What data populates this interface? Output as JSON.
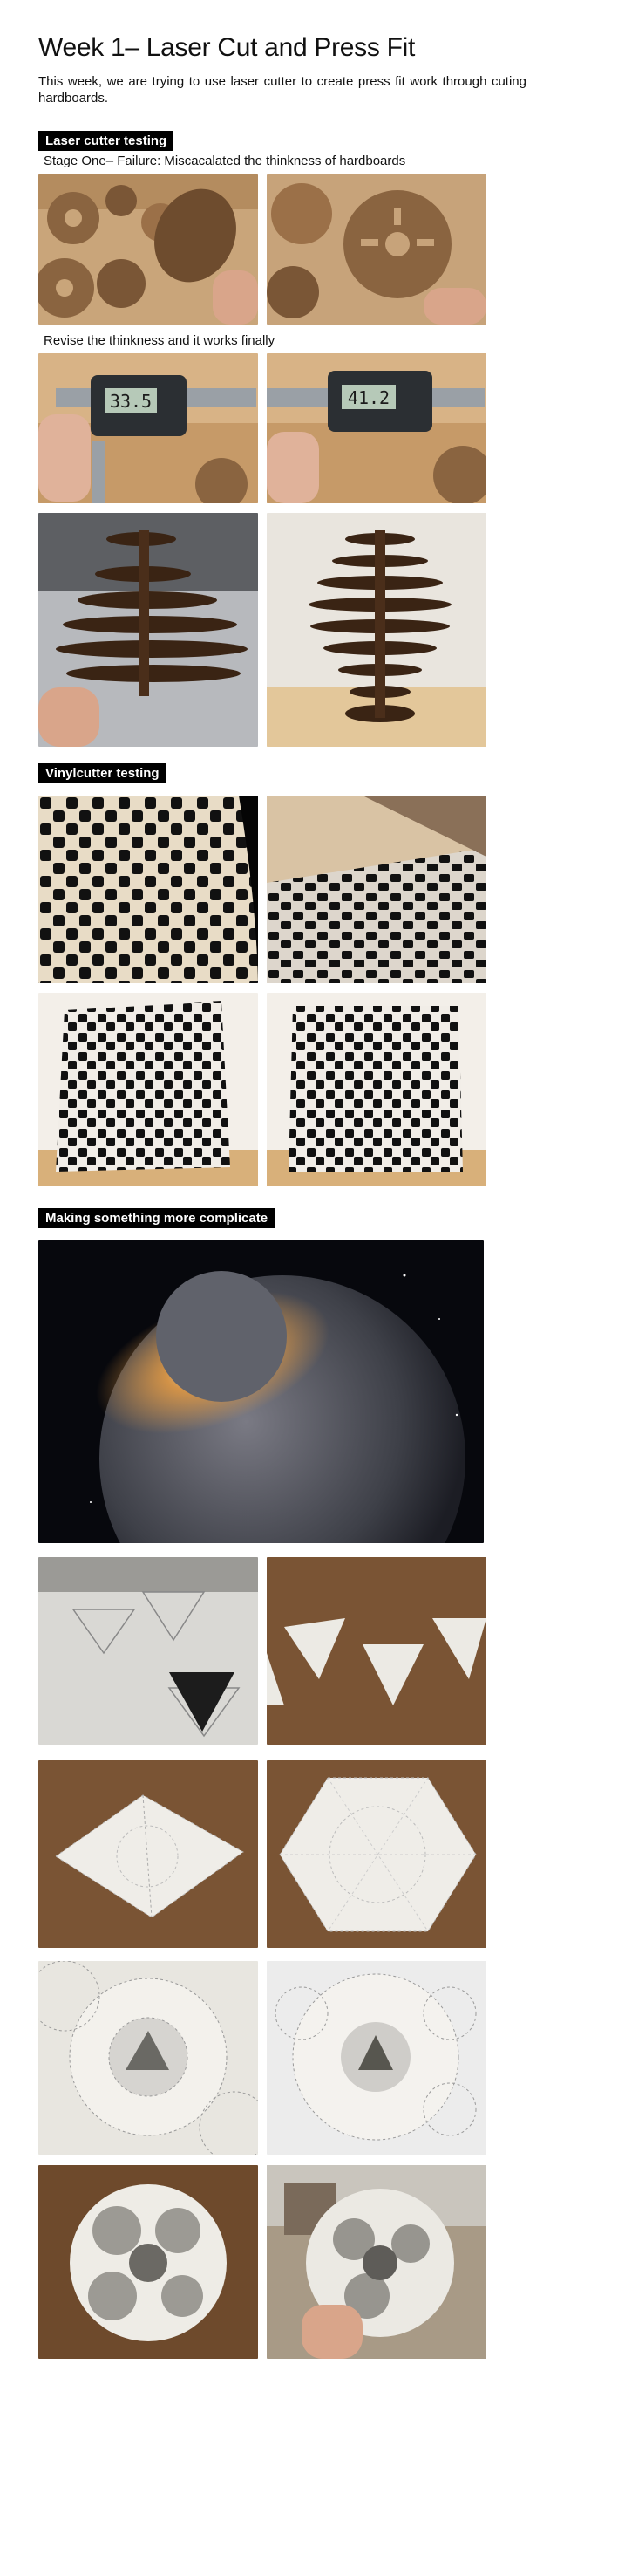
{
  "header": {
    "title": "Week 1– Laser Cut and Press Fit",
    "intro": "This week, we are trying to use laser cutter to create press fit work through cuting  hardboards."
  },
  "sections": {
    "laser": {
      "label": "Laser cutter testing",
      "caption1": "Stage One– Failure: Miscacalated the thinkness of hardboards",
      "caption2": "Revise the thinkness and it works finally",
      "caliper1": "33.5",
      "caliper2": "41.2"
    },
    "vinyl": {
      "label": "Vinylcutter testing"
    },
    "complex": {
      "label": "Making something more complicate"
    }
  }
}
